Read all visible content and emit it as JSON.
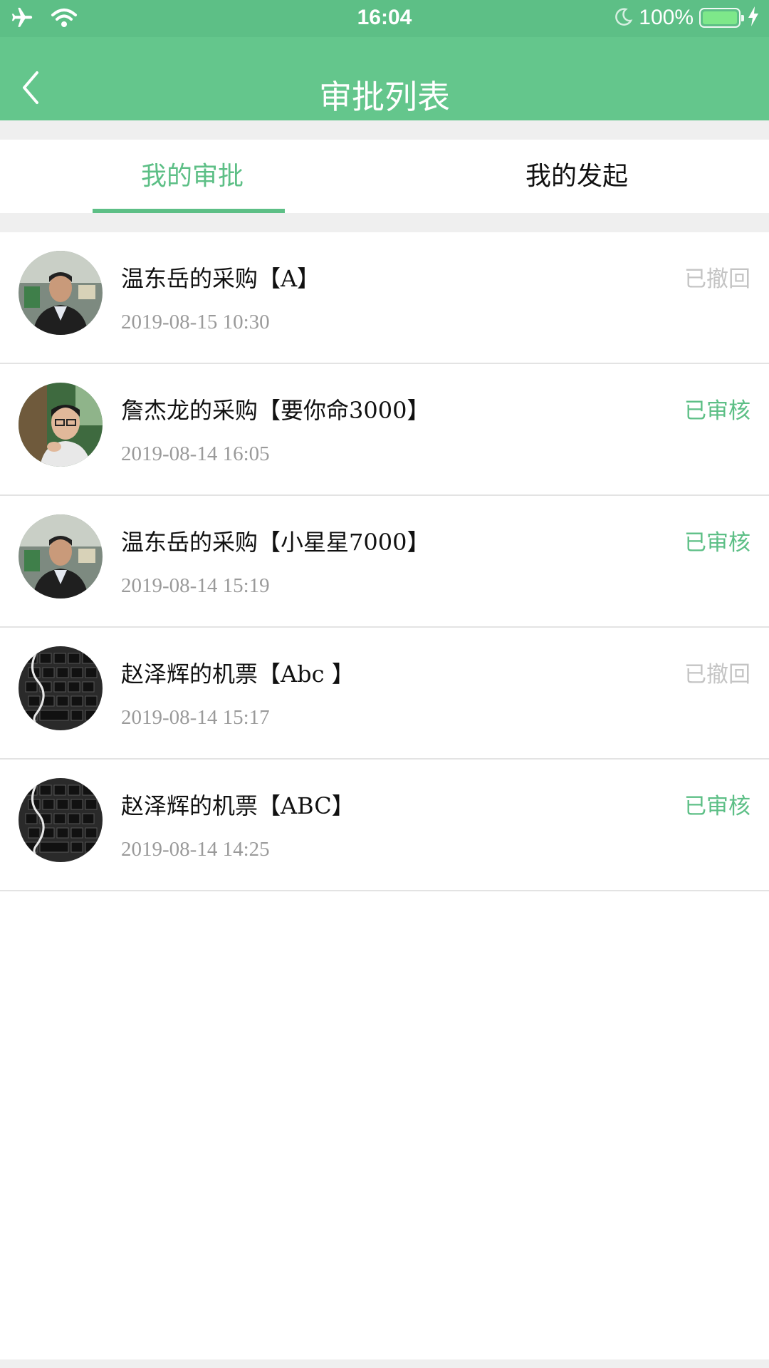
{
  "status_bar": {
    "time": "16:04",
    "battery_percent": "100%",
    "icons": [
      "airplane-icon",
      "wifi-icon",
      "moon-icon",
      "battery-icon",
      "charging-icon"
    ]
  },
  "nav": {
    "title": "审批列表",
    "back_icon": "chevron-left-icon"
  },
  "tabs": [
    {
      "label": "我的审批",
      "active": true
    },
    {
      "label": "我的发起",
      "active": false
    }
  ],
  "colors": {
    "accent": "#5dbf86",
    "status_approved": "#5dbf86",
    "status_withdrawn": "#c4c4c4"
  },
  "items": [
    {
      "title": "温东岳的采购【A】",
      "time": "2019-08-15 10:30",
      "status": "已撤回",
      "status_type": "withdrawn",
      "avatar": "person-photo"
    },
    {
      "title": "詹杰龙的采购【要你命3000】",
      "time": "2019-08-14 16:05",
      "status": "已审核",
      "status_type": "approved",
      "avatar": "person-photo"
    },
    {
      "title": "温东岳的采购【小星星7000】",
      "time": "2019-08-14 15:19",
      "status": "已审核",
      "status_type": "approved",
      "avatar": "person-photo"
    },
    {
      "title": "赵泽辉的机票【Abc 】",
      "time": "2019-08-14 15:17",
      "status": "已撤回",
      "status_type": "withdrawn",
      "avatar": "keyboard-photo"
    },
    {
      "title": "赵泽辉的机票【ABC】",
      "time": "2019-08-14 14:25",
      "status": "已审核",
      "status_type": "approved",
      "avatar": "keyboard-photo"
    }
  ]
}
